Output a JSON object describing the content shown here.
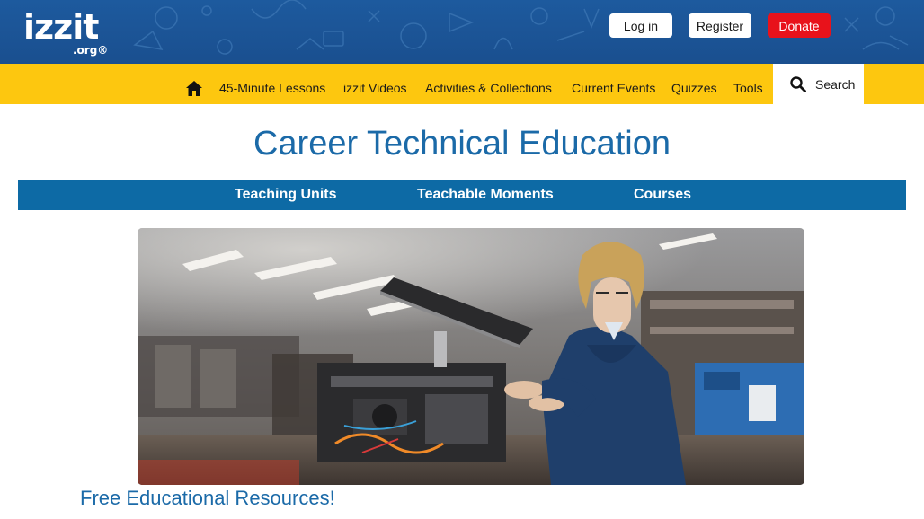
{
  "header": {
    "logo_main": "izzit",
    "logo_sub": ".org®",
    "login_label": "Log in",
    "register_label": "Register",
    "donate_label": "Donate"
  },
  "nav": {
    "items": [
      {
        "label": "45-Minute Lessons"
      },
      {
        "label": "izzit Videos"
      },
      {
        "label": "Activities & Collections"
      },
      {
        "label": "Current Events"
      },
      {
        "label": "Quizzes"
      },
      {
        "label": "Tools"
      }
    ],
    "search_label": "Search"
  },
  "page": {
    "title": "Career Technical Education",
    "subnav": [
      {
        "label": "Teaching Units"
      },
      {
        "label": "Teachable Moments"
      },
      {
        "label": "Courses"
      }
    ],
    "section_heading": "Free Educational Resources!"
  },
  "colors": {
    "header_blue": "#1d5a9e",
    "nav_yellow": "#fdc70f",
    "subnav_blue": "#0d6aa5",
    "title_blue": "#1b6aa8",
    "donate_red": "#e8121b"
  }
}
